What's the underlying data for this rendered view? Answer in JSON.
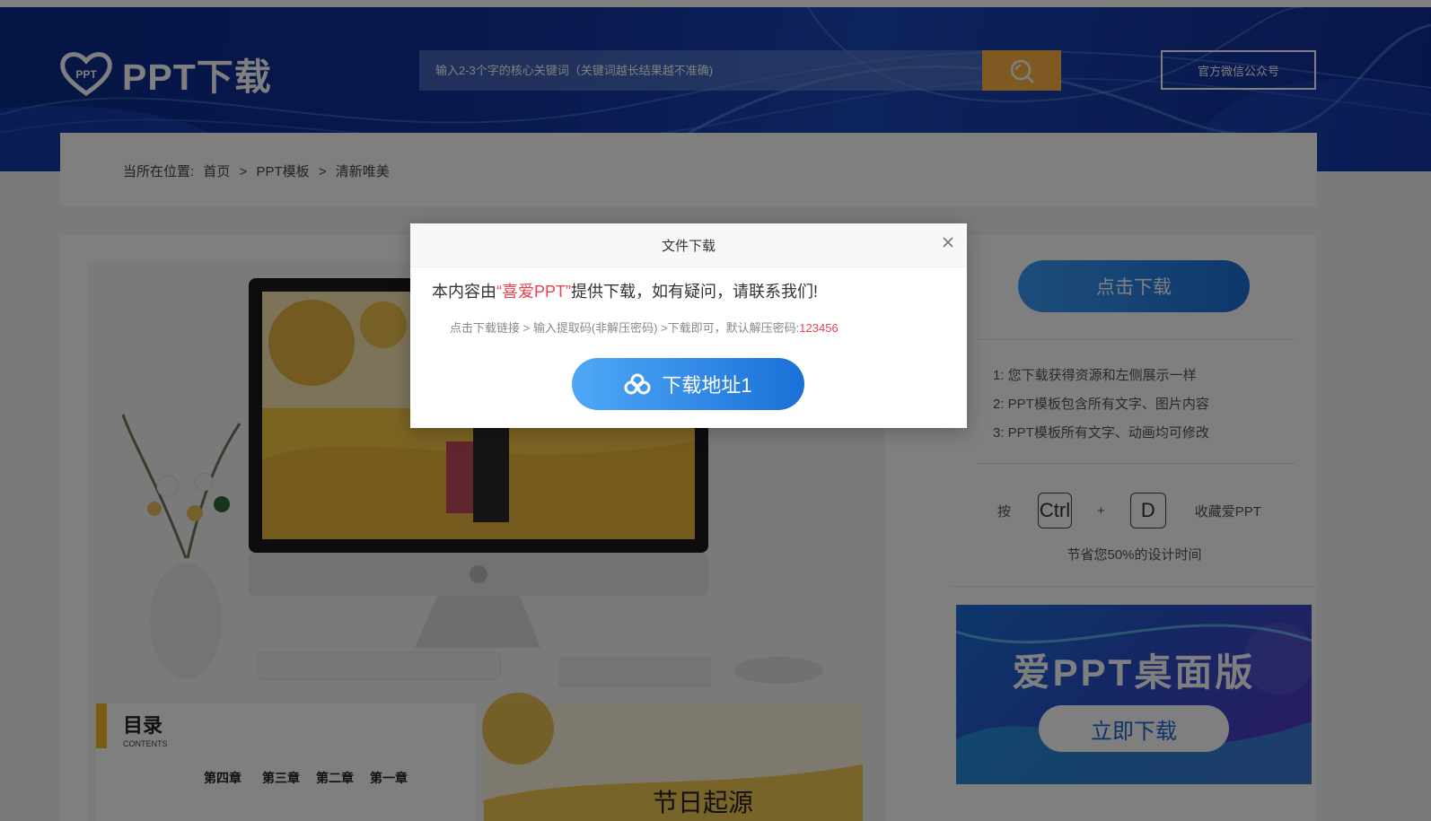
{
  "header": {
    "logo_text": "PPT下载",
    "logo_badge": "PPT",
    "search_placeholder": "输入2-3个字的核心关键词（关键词越长结果越不准确)",
    "wechat_label": "官方微信公众号"
  },
  "breadcrumb": {
    "prefix": "当所在位置:",
    "items": [
      "首页",
      "PPT模板",
      "清新唯美"
    ],
    "separator": ">"
  },
  "preview": {
    "thumb1_title": "目录",
    "thumb1_subtitle": "CONTENTS",
    "thumb1_chapters": [
      "第四章",
      "第三章",
      "第二章",
      "第一章"
    ],
    "thumb2_title": "节日起源"
  },
  "sidebar": {
    "download_label": "点击下载",
    "tips": [
      "1:  您下载获得资源和左侧展示一样",
      "2:  PPT模板包含所有文字、图片内容",
      "3:  PPT模板所有文字、动画均可修改"
    ],
    "fav_press": "按",
    "fav_key1": "Ctrl",
    "fav_plus": "+",
    "fav_key2": "D",
    "fav_label": "收藏爱PPT",
    "save_time": "节省您50%的设计时间"
  },
  "ad": {
    "title": "爱PPT桌面版",
    "button": "立即下载"
  },
  "modal": {
    "title": "文件下载",
    "msg_before": "本内容由",
    "msg_brand": "“喜爱PPT”",
    "msg_after": "提供下载，如有疑问，请联系我们!",
    "sub_text": "点击下载链接 > 输入提取码(非解压密码) >下载即可，默认解压密码:",
    "password": "123456",
    "download_button": "下载地址1"
  },
  "colors": {
    "banner": "#12329c",
    "search_button": "#fdb544",
    "accent_red": "#e8424f",
    "download_blue": "#1b70d8"
  }
}
